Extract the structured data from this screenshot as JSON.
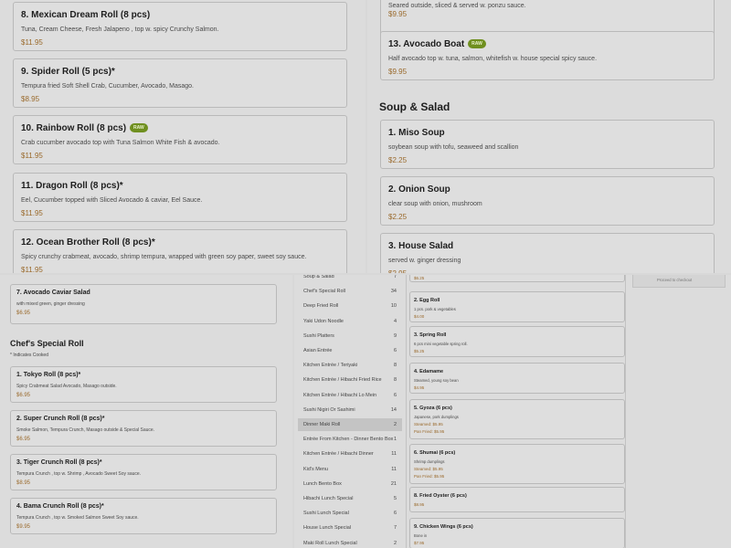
{
  "top_left": {
    "items": [
      {
        "name": "8. Mexican Dream Roll (8 pcs)",
        "raw": "",
        "desc": "Tuna, Cream Cheese, Fresh Jalapeno , top w. spicy Crunchy Salmon.",
        "price": "$11.95"
      },
      {
        "name": "9. Spider Roll (5 pcs)*",
        "raw": "",
        "desc": "Tempura fried Soft Shell Crab, Cucumber, Avocado, Masago.",
        "price": "$8.95"
      },
      {
        "name": "10. Rainbow Roll (8 pcs)",
        "raw": "RAW",
        "desc": "Crab cucumber avocado top with Tuna Salmon White Fish & avocado.",
        "price": "$11.95"
      },
      {
        "name": "11. Dragon Roll (8 pcs)*",
        "raw": "",
        "desc": "Eel, Cucumber topped with Sliced Avocado & caviar, Eel Sauce.",
        "price": "$11.95"
      },
      {
        "name": "12. Ocean Brother Roll (8 pcs)*",
        "raw": "",
        "desc": "Spicy crunchy crabmeat, avocado, shrimp tempura, wrapped with green soy paper, sweet soy sauce.",
        "price": "$11.95"
      }
    ]
  },
  "top_right": {
    "partial_desc": "Seared outside, sliced & served w. ponzu sauce.",
    "partial_price": "$9.95",
    "boat": {
      "name": "13. Avocado Boat",
      "raw": "RAW",
      "desc": "Half avocado top w. tuna, salmon, whitefish w. house special spicy sauce.",
      "price": "$9.95"
    },
    "section_title": "Soup & Salad",
    "items": [
      {
        "name": "1. Miso Soup",
        "desc": "soybean soup with tofu, seaweed and scallion",
        "price": "$2.25"
      },
      {
        "name": "2. Onion Soup",
        "desc": "clear soup with onion, mushroom",
        "price": "$2.25"
      },
      {
        "name": "3. House Salad",
        "desc": "served w. ginger dressing",
        "price": "$2.95"
      }
    ]
  },
  "bottom_left": {
    "caviar": {
      "name": "7. Avocado Caviar Salad",
      "desc": "with mixed green, ginger dressing",
      "price": "$6.95"
    },
    "section_title": "Chef's Special Roll",
    "section_note": "* Indicates Cooked",
    "items": [
      {
        "name": "1. Tokyo Roll (8 pcs)*",
        "desc": "Spicy Crabmeat Salad Avocado, Masago outside.",
        "price": "$6.95"
      },
      {
        "name": "2. Super Crunch Roll (8 pcs)*",
        "desc": "Smoke Salmon, Tempura Crunch, Masago outside & Special Sauce.",
        "price": "$6.95"
      },
      {
        "name": "3. Tiger Crunch Roll (8 pcs)*",
        "desc": "Tempura Crunch , top w. Shrimp , Avocado Sweet Soy sauce.",
        "price": "$8.95"
      },
      {
        "name": "4. Bama Crunch Roll (8 pcs)*",
        "desc": "Tempura Crunch , top w. Smoked Salmon Sweet Soy sauce.",
        "price": "$9.95"
      }
    ]
  },
  "bottom_right": {
    "categories": [
      {
        "name": "Soup & Salad",
        "count": "7"
      },
      {
        "name": "Chef's Special Roll",
        "count": "34"
      },
      {
        "name": "Deep Fried Roll",
        "count": "10"
      },
      {
        "name": "Yaki Udon Noodle",
        "count": "4"
      },
      {
        "name": "Sushi Platters",
        "count": "9"
      },
      {
        "name": "Asian Entrée",
        "count": "6"
      },
      {
        "name": "Kitchen Entrée / Teriyaki",
        "count": "8"
      },
      {
        "name": "Kitchen Entrée / Hibachi Fried Rice",
        "count": "8"
      },
      {
        "name": "Kitchen Entrée / Hibachi Lo Mein",
        "count": "6"
      },
      {
        "name": "Sushi Nigiri Or Sashimi",
        "count": "14"
      },
      {
        "name": "Dinner Maki Roll",
        "count": "2"
      },
      {
        "name": "Entrée From Kitchen - Dinner Bento Box",
        "count": "1"
      },
      {
        "name": "Kitchen Entrée / Hibachi Dinner",
        "count": "11"
      },
      {
        "name": "Kid's Menu",
        "count": "11"
      },
      {
        "name": "Lunch Bento Box",
        "count": "21"
      },
      {
        "name": "Hibachi Lunch Special",
        "count": "5"
      },
      {
        "name": "Sushi Lunch Special",
        "count": "6"
      },
      {
        "name": "House Lunch Special",
        "count": "7"
      },
      {
        "name": "Maki Roll Lunch Special",
        "count": "2"
      }
    ],
    "active_category": "Dinner Maki Roll",
    "partial_price": "$6.25",
    "items": [
      {
        "name": "2. Egg Roll",
        "desc": "1 pcs. pork & vegetables",
        "lines": [
          "$4.00"
        ]
      },
      {
        "name": "3. Spring Roll",
        "desc": "6 pcs mini vegetable spring roll.",
        "lines": [
          "$5.25"
        ]
      },
      {
        "name": "4. Edamame",
        "desc": "Steamed, young soy bean",
        "lines": [
          "$4.95"
        ]
      },
      {
        "name": "5. Gyoza (6 pcs)",
        "desc": "Japanese, pork dumplings",
        "lines": [
          "Steamed: $5.95",
          "Pan Fried: $5.95"
        ]
      },
      {
        "name": "6. Shumai (6 pcs)",
        "desc": "Shrimp dumplings",
        "lines": [
          "Steamed: $5.95",
          "Pan Fried: $5.95"
        ]
      },
      {
        "name": "8. Fried Oyster (6 pcs)",
        "desc": "",
        "lines": [
          "$8.95"
        ]
      },
      {
        "name": "9. Chicken Wings (6 pcs)",
        "desc": "Bone in",
        "lines": [
          "$7.95"
        ]
      }
    ],
    "cart_text": "Proceed to checkout"
  }
}
